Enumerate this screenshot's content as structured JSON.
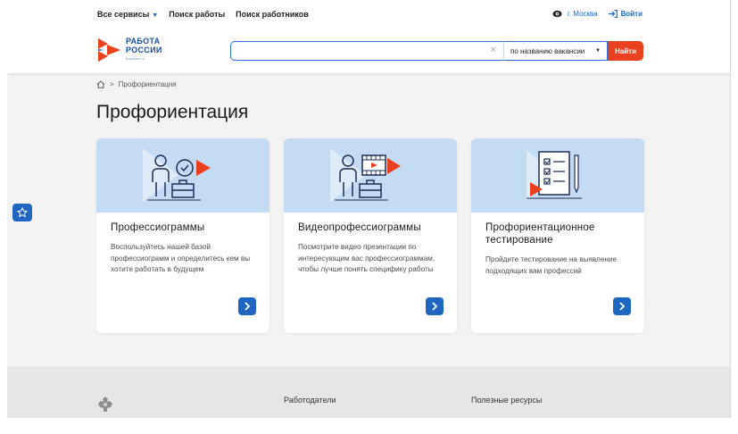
{
  "topbar": {
    "nav": [
      "Все сервисы",
      "Поиск работы",
      "Поиск работников"
    ],
    "city": "г. Москва",
    "login": "Войти"
  },
  "logo": {
    "line1": "РАБОТА",
    "line2": "РОССИИ",
    "sub": "trudvsem.ru"
  },
  "search": {
    "value": "",
    "placeholder": "",
    "mode": "по названию вакансии",
    "button": "Найти"
  },
  "breadcrumb": {
    "current": "Профориентация"
  },
  "page": {
    "title": "Профориентация"
  },
  "cards": [
    {
      "title": "Профессиограммы",
      "desc": "Воспользуйтесь нашей базой профессиограмм и определитесь кем вы хотите работать в будущем"
    },
    {
      "title": "Видеопрофессиограммы",
      "desc": "Посмотрите видео презентации по интересующим вас профессиограммам, чтобы лучше понять специфику работы"
    },
    {
      "title": "Профориентационное тестирование",
      "desc": "Пройдите тестирование на выявление подходящих вам профессий"
    }
  ],
  "footer": {
    "col1": "Работодатели",
    "col2": "Полезные ресурсы"
  },
  "colors": {
    "accent": "#1f66c0",
    "brand_orange": "#e9411f",
    "card_bg": "#c3dcf4"
  }
}
